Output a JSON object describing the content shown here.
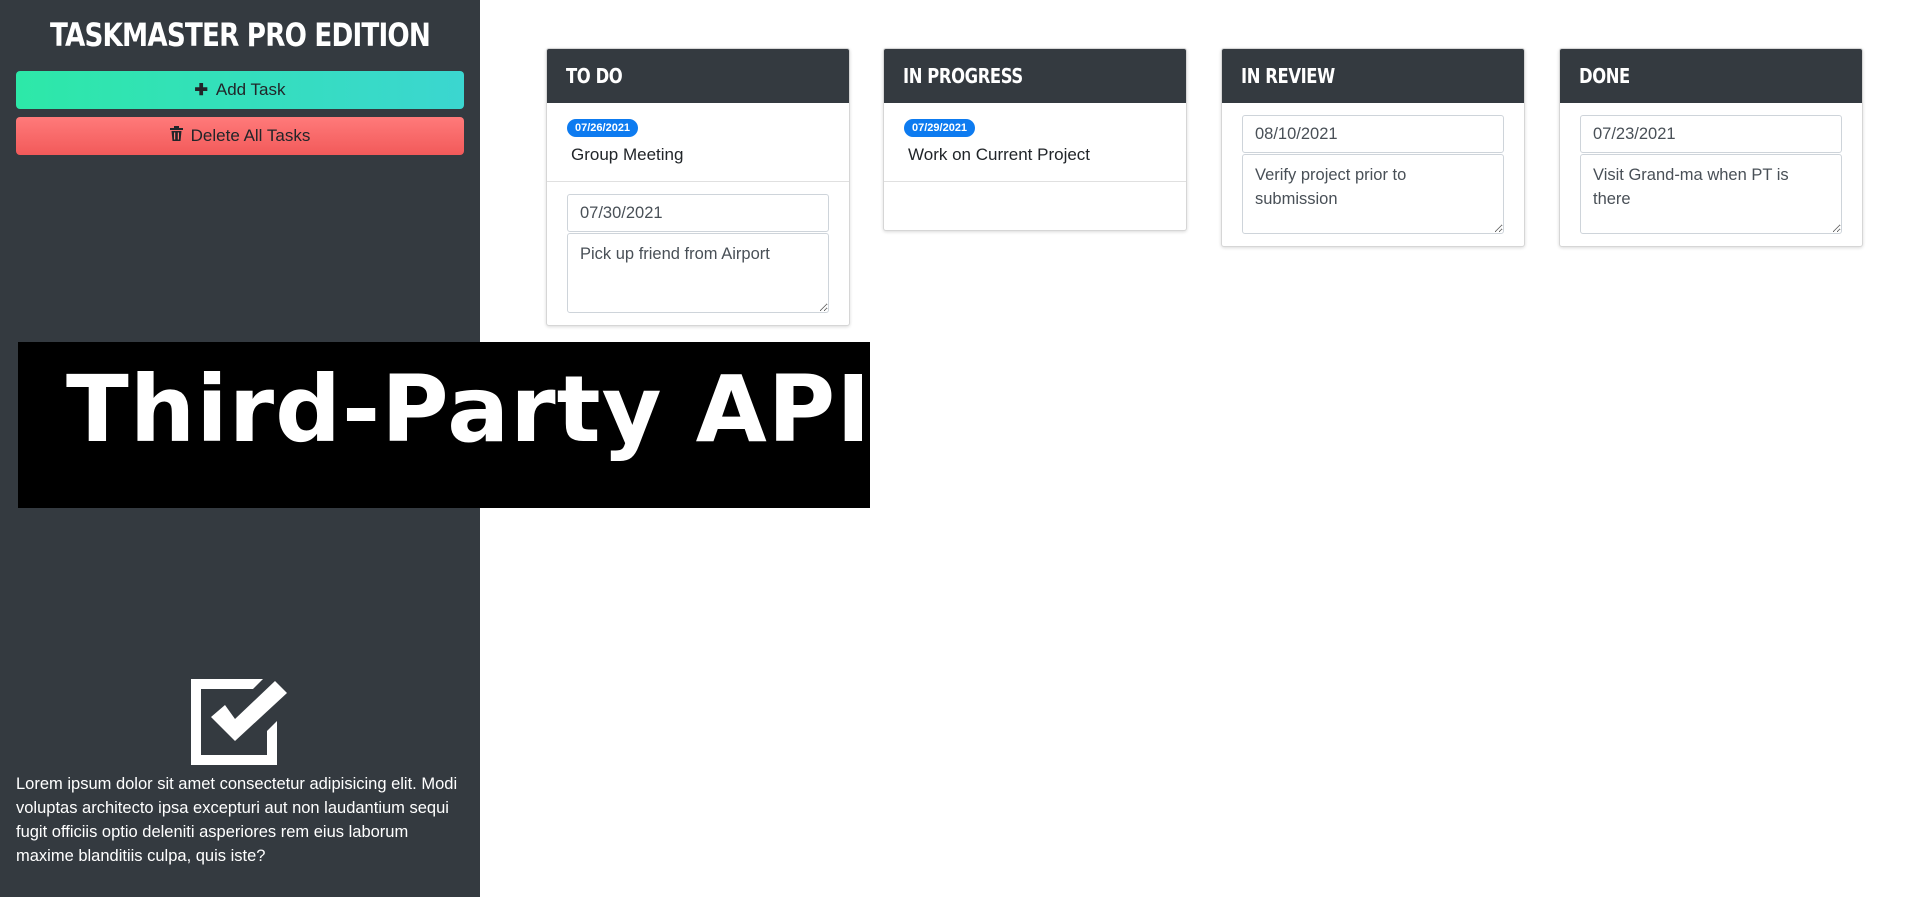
{
  "sidebar": {
    "title": "TASKMASTER PRO EDITION",
    "add_task_label": "Add Task",
    "add_task_icon": "plus-icon",
    "delete_all_label": "Delete All Tasks",
    "delete_all_icon": "trash-icon",
    "logo_icon": "checkbox-checked-icon",
    "description": "Lorem ipsum dolor sit amet consectetur adipisicing elit. Modi voluptas architecto ipsa excepturi aut non laudantium sequi fugit officiis optio deleniti asperiores rem eius laborum maxime blanditiis culpa, quis iste?"
  },
  "banner": {
    "text": "Third-Party APIs"
  },
  "columns": [
    {
      "title": "To Do",
      "tasks": [
        {
          "date": "07/26/2021",
          "text": "Group Meeting"
        }
      ],
      "editing": {
        "date": "07/30/2021",
        "text": "Pick up friend from Airport"
      }
    },
    {
      "title": "In Progress",
      "tasks": [
        {
          "date": "07/29/2021",
          "text": "Work on Current Project"
        }
      ]
    },
    {
      "title": "In Review",
      "editing": {
        "date": "08/10/2021",
        "text": "Verify project prior to submission"
      }
    },
    {
      "title": "Done",
      "editing": {
        "date": "07/23/2021",
        "text": "Visit Grand-ma when PT is there"
      }
    }
  ],
  "colors": {
    "sidebar_bg": "#343a40",
    "add_button": "#2de8a8",
    "delete_button": "#f25a5a",
    "badge": "#0d7bf0"
  }
}
